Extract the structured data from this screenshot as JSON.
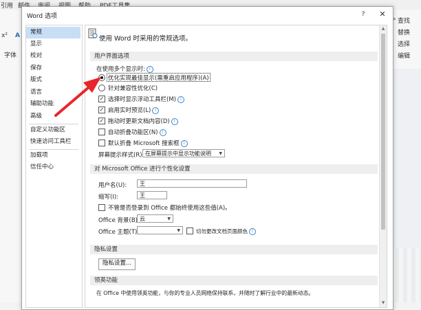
{
  "background": {
    "menu": [
      "引用",
      "邮件",
      "审阅",
      "视图",
      "帮助",
      "PDF工具集"
    ],
    "left_items": [
      "x²",
      "A",
      "字体"
    ],
    "right_items": [
      "查找",
      "替换",
      "选择",
      "编辑"
    ]
  },
  "dialog": {
    "title": "Word 选项",
    "help": "?",
    "close": "✕"
  },
  "nav": {
    "items": [
      "常规",
      "显示",
      "校对",
      "保存",
      "版式",
      "语言",
      "辅助功能",
      "高级",
      "自定义功能区",
      "快速访问工具栏",
      "加载项",
      "信任中心"
    ],
    "selected": 0
  },
  "general": {
    "intro": "使用 Word 时采用的常规选项。",
    "ui_section": "用户界面选项",
    "multi_display_label": "在使用多个显示时:",
    "radio_optimize": "优化实现最佳显示(需重启应用程序)(A)",
    "radio_compat": "针对兼容性优化(C)",
    "check_minitoolbar": "选择时显示浮动工具栏(M)",
    "check_livepreview": "启用实时预览(L)",
    "check_drag_update": "拖动时更新文档内容(D)",
    "check_collapse_ribbon": "自动折叠功能区(N)",
    "check_collapse_search": "默认折叠 Microsoft 搜索框",
    "screentip_label": "屏幕提示样式(R):",
    "screentip_value": "在屏幕提示中显示功能说明",
    "personalize_section": "对 Microsoft Office 进行个性化设置",
    "username_label": "用户名(U):",
    "username_value": "王",
    "initials_label": "缩写(I):",
    "initials_value": "王",
    "always_use_label": "不管是否登录到 Office 都始终使用这些值(A)。",
    "office_bg_label": "Office 背景(B):",
    "office_bg_value": "云",
    "office_theme_label": "Office 主题(T):",
    "office_theme_value": "",
    "page_color_label": "切勿更改文档页面颜色",
    "privacy_section": "隐私设置",
    "privacy_button": "隐私设置...",
    "linkedin_section": "领英功能",
    "linkedin_desc": "在 Office 中使用领英功能，与你的专业人员网络保持联系，并随时了解行业中的最新动态。"
  },
  "states": {
    "radio_optimize": true,
    "radio_compat": false,
    "check_minitoolbar": true,
    "check_livepreview": true,
    "check_drag_update": true,
    "check_collapse_ribbon": false,
    "check_collapse_search": false,
    "check_always_use": false,
    "check_page_color": false
  },
  "colors": {
    "annotation_arrow": "#e8262b",
    "nav_selected": "#c8def5",
    "section_bg": "#eeeeee"
  }
}
